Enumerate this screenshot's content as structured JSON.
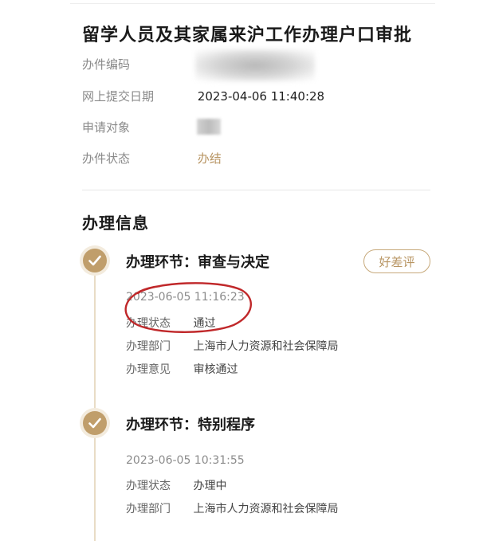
{
  "header": {
    "title": "留学人员及其家属来沪工作办理户口审批"
  },
  "info": {
    "case_number_label": "办件编码",
    "case_number_value": "",
    "submit_date_label": "网上提交日期",
    "submit_date_value": "2023-04-06 11:40:28",
    "applicant_label": "申请对象",
    "applicant_value": "",
    "status_label": "办件状态",
    "status_value": "办结"
  },
  "processing": {
    "section_title": "办理信息",
    "rate_button_label": "好差评",
    "steps": [
      {
        "title": "办理环节：审查与决定",
        "time": "2023-06-05 11:16:23",
        "status_label": "办理状态",
        "status_value": "通过",
        "department_label": "办理部门",
        "department_value": "上海市人力资源和社会保障局",
        "opinion_label": "办理意见",
        "opinion_value": "审核通过"
      },
      {
        "title": "办理环节：特别程序",
        "time": "2023-06-05 10:31:55",
        "status_label": "办理状态",
        "status_value": "办理中",
        "department_label": "办理部门",
        "department_value": "上海市人力资源和社会保障局"
      }
    ]
  },
  "colors": {
    "accent": "#b89563",
    "check_circle": "#c09e6b",
    "annotation": "#c0282a"
  },
  "icons": {
    "step_icon": "check-icon"
  }
}
